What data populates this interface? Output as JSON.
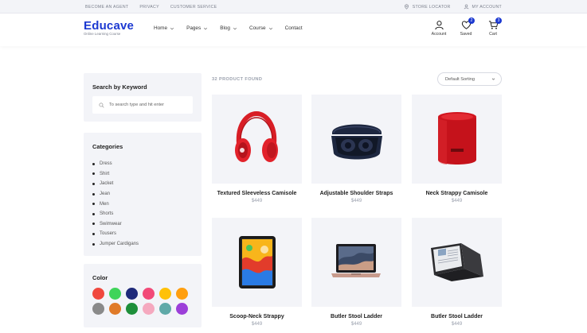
{
  "topbar": {
    "links": [
      "BECOME AN AGENT",
      "PRIVACY",
      "CUSTOMER SERVICE"
    ],
    "store_locator": "STORE LOCATOR",
    "my_account": "MY ACCOUNT"
  },
  "header": {
    "logo_name": "Educave",
    "logo_tagline": "Online Learning Course",
    "nav": [
      "Home",
      "Pages",
      "Blog",
      "Course",
      "Contact"
    ],
    "account_label": "Account",
    "saved_label": "Saved",
    "saved_count": "2",
    "cart_label": "Cart",
    "cart_count": "3"
  },
  "sidebar": {
    "search_heading": "Search by Keyword",
    "search_placeholder": "To search type and hit enter",
    "categories_heading": "Categories",
    "categories": [
      "Dress",
      "Shirt",
      "Jacket",
      "Jean",
      "Men",
      "Shorts",
      "Swimwear",
      "Tousers",
      "Jumper Cardigans"
    ],
    "color_heading": "Color",
    "colors": [
      "#f0483e",
      "#3fd45a",
      "#1f2a7a",
      "#f24a78",
      "#ffc107",
      "#ff9f10",
      "#8a8a8a",
      "#e07a28",
      "#1e8f3a",
      "#f5a9bf",
      "#5fa9a8",
      "#9c3fd9"
    ]
  },
  "toolbar": {
    "found": "32 PRODUCT FOUND",
    "sort": "Default Sorting"
  },
  "products": [
    {
      "title": "Textured Sleeveless Camisole",
      "price": "$449",
      "icon": "headphones-icon"
    },
    {
      "title": "Adjustable Shoulder Straps",
      "price": "$449",
      "icon": "earbuds-icon"
    },
    {
      "title": "Neck Strappy Camisole",
      "price": "$449",
      "icon": "speaker-icon"
    },
    {
      "title": "Scoop-Neck Strappy",
      "price": "$449",
      "icon": "tablet-icon"
    },
    {
      "title": "Butler Stool Ladder",
      "price": "$449",
      "icon": "laptop-icon"
    },
    {
      "title": "Butler Stool Ladder",
      "price": "$449",
      "icon": "convertible-laptop-icon"
    }
  ]
}
